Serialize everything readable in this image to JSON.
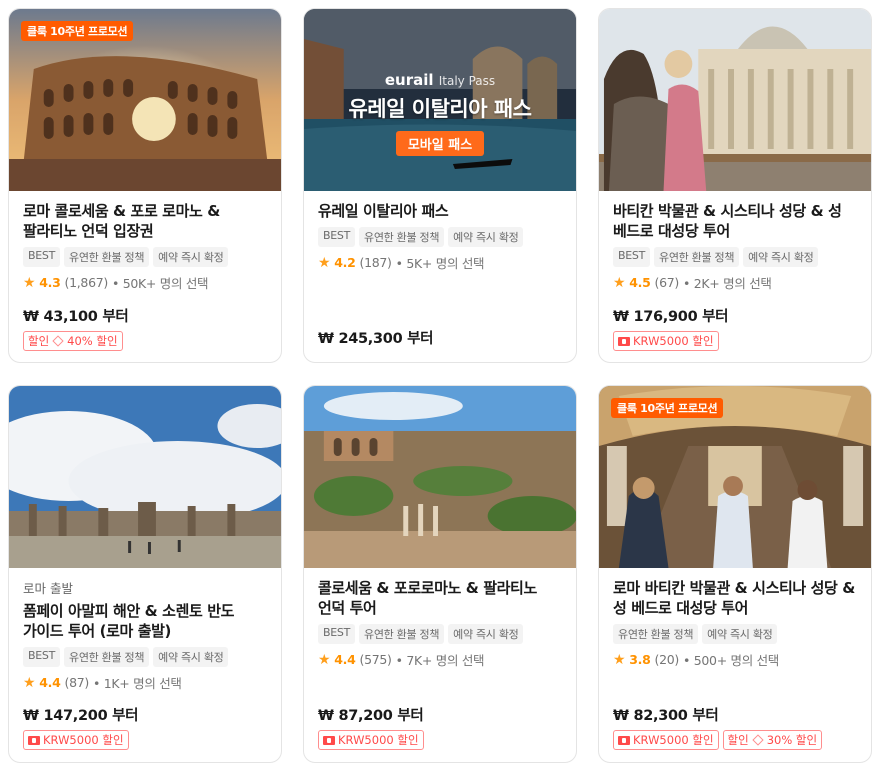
{
  "cards": [
    {
      "promo": "클룩 10주년 프로모션",
      "subtitle": "",
      "title": "로마 콜로세움 & 포로 로마노 & 팔라티노 언덕 입장권",
      "tags": [
        "BEST",
        "유연한 환불 정책",
        "예약 즉시 확정"
      ],
      "rating": "4.3",
      "reviews": "(1,867)",
      "bookings": "• 50K+ 명의 선택",
      "price": "₩ 43,100 부터",
      "discount": {
        "label": "할인",
        "value": "40% 할인"
      },
      "coupon": ""
    },
    {
      "promo": "",
      "overlay": {
        "brand": "eurail",
        "brand_sub": "Italy Pass",
        "headline": "유레일 이탈리아 패스",
        "pill": "모바일 패스"
      },
      "subtitle": "",
      "title": "유레일 이탈리아 패스",
      "tags": [
        "BEST",
        "유연한 환불 정책",
        "예약 즉시 확정"
      ],
      "rating": "4.2",
      "reviews": "(187)",
      "bookings": "• 5K+ 명의 선택",
      "price": "₩ 245,300 부터",
      "coupon": ""
    },
    {
      "promo": "",
      "subtitle": "",
      "title": "바티칸 박물관 & 시스티나 성당 & 성 베드로 대성당 투어",
      "tags": [
        "BEST",
        "유연한 환불 정책",
        "예약 즉시 확정"
      ],
      "rating": "4.5",
      "reviews": "(67)",
      "bookings": "• 2K+ 명의 선택",
      "price": "₩ 176,900 부터",
      "coupon": "KRW5000 할인"
    },
    {
      "promo": "",
      "subtitle": "로마 출발",
      "title": "폼페이 아말피 해안 & 소렌토 반도 가이드 투어 (로마 출발)",
      "tags": [
        "BEST",
        "유연한 환불 정책",
        "예약 즉시 확정"
      ],
      "rating": "4.4",
      "reviews": "(87)",
      "bookings": "• 1K+ 명의 선택",
      "price": "₩ 147,200 부터",
      "coupon": "KRW5000 할인"
    },
    {
      "promo": "",
      "subtitle": "",
      "title": "콜로세움 & 포로로마노 & 팔라티노 언덕 투어",
      "tags": [
        "BEST",
        "유연한 환불 정책",
        "예약 즉시 확정"
      ],
      "rating": "4.4",
      "reviews": "(575)",
      "bookings": "• 7K+ 명의 선택",
      "price": "₩ 87,200 부터",
      "coupon": "KRW5000 할인"
    },
    {
      "promo": "클룩 10주년 프로모션",
      "subtitle": "",
      "title": "로마 바티칸 박물관 & 시스티나 성당 & 성 베드로 대성당 투어",
      "tags": [
        "유연한 환불 정책",
        "예약 즉시 확정"
      ],
      "rating": "3.8",
      "reviews": "(20)",
      "bookings": "• 500+ 명의 선택",
      "price": "₩ 82,300 부터",
      "coupon": "KRW5000 할인",
      "discount": {
        "label": "할인",
        "value": "30% 할인"
      }
    }
  ],
  "colors": {
    "accent": "#ff5b00",
    "star": "#ff9200",
    "discount": "#ff4a4a"
  }
}
